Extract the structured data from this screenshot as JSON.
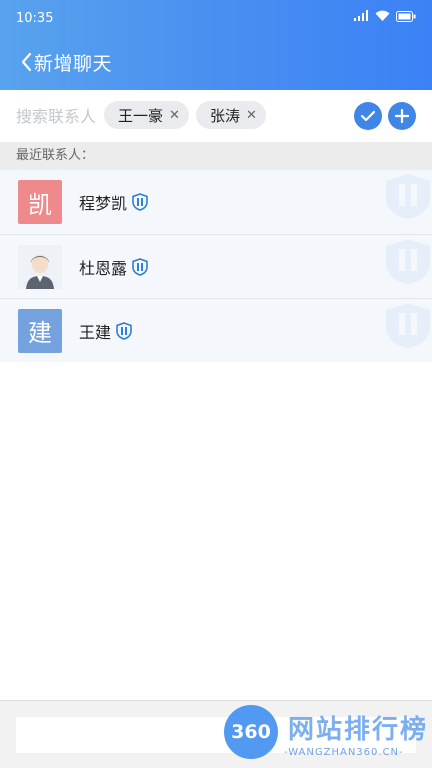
{
  "status_bar": {
    "time": "10:35",
    "icons": [
      "signal-icon",
      "wifi-icon",
      "battery-icon"
    ]
  },
  "header": {
    "title": "新增聊天",
    "back_icon": "chevron-left-icon",
    "gradient": [
      "#58a3ee",
      "#3b82f6"
    ]
  },
  "search": {
    "placeholder": "搜索联系人",
    "selected": [
      {
        "name": "王一豪",
        "remove_icon": "close-icon"
      },
      {
        "name": "张涛",
        "remove_icon": "close-icon"
      }
    ],
    "confirm_icon": "check-icon",
    "add_icon": "plus-icon",
    "accent": "#3f86e8"
  },
  "recent": {
    "label": "最近联系人：",
    "contacts": [
      {
        "avatar_text": "凯",
        "avatar_color": "#ef8a8c",
        "name": "程梦凯",
        "badge_icon": "shield-icon"
      },
      {
        "avatar_text": "",
        "avatar_icon": "user-photo-icon",
        "name": "杜恩露",
        "badge_icon": "shield-icon"
      },
      {
        "avatar_text": "建",
        "avatar_color": "#74a2df",
        "name": "王建",
        "badge_icon": "shield-icon"
      }
    ]
  },
  "footer": {
    "message_value": "",
    "watermark": {
      "badge": "360",
      "title": "网站排行榜",
      "subtitle": "-WANGZHAN360.CN-"
    }
  }
}
